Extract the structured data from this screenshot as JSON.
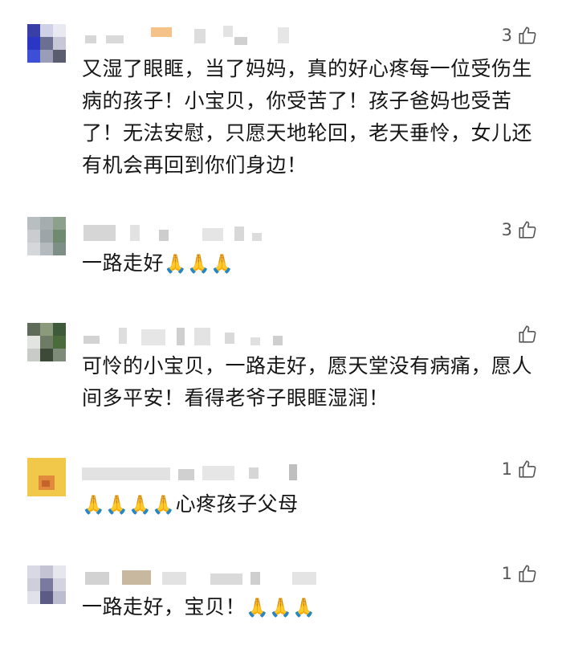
{
  "comments": [
    {
      "text": "又湿了眼眶，当了妈妈，真的好心疼每一位受伤生病的孩子！小宝贝，你受苦了！孩子爸妈也受苦了！无法安慰，只愿天地轮回，老天垂怜，女儿还有机会再回到你们身边！",
      "likes": "3"
    },
    {
      "text": "一路走好",
      "emoji": "🙏🙏🙏",
      "likes": "3"
    },
    {
      "text": "可怜的小宝贝，一路走好，愿天堂没有病痛，愿人间多平安！看得老爷子眼眶湿润！",
      "likes": ""
    },
    {
      "emoji": "🙏🙏🙏🙏",
      "text": "心疼孩子父母",
      "likes": "1"
    },
    {
      "text": "一路走好，宝贝！",
      "emoji": "🙏🙏🙏",
      "likes": "1"
    }
  ],
  "colors": {
    "text": "#161616",
    "meta": "#555555",
    "background": "#ffffff"
  },
  "icons": {
    "like": "thumbs-up-outline-icon"
  }
}
